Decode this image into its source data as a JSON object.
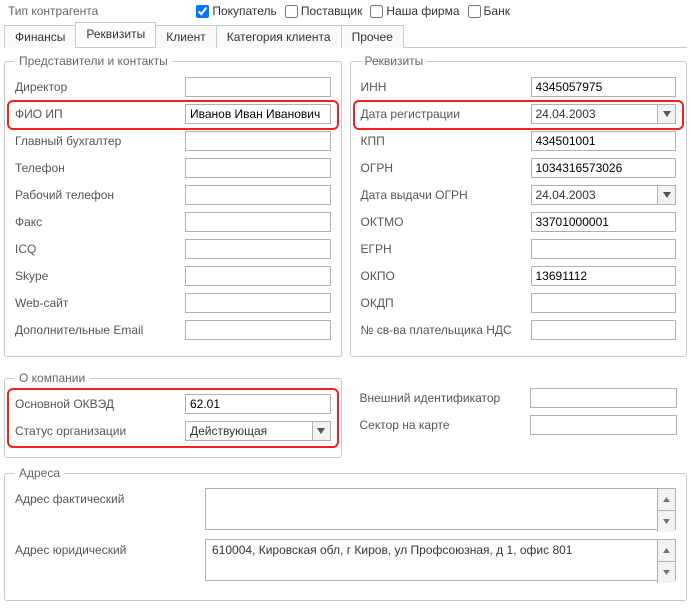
{
  "top": {
    "label": "Тип контрагента",
    "cb_buyer": "Покупатель",
    "cb_supplier": "Поставщик",
    "cb_ourfirm": "Наша фирма",
    "cb_bank": "Банк"
  },
  "tabs": {
    "t0": "Финансы",
    "t1": "Реквизиты",
    "t2": "Клиент",
    "t3": "Категория клиента",
    "t4": "Прочее"
  },
  "fs": {
    "contacts": "Представители и контакты",
    "details": "Реквизиты",
    "company": "О компании",
    "addresses": "Адреса"
  },
  "contacts": {
    "l_director": "Директор",
    "l_fioip": "ФИО ИП",
    "v_fioip": "Иванов Иван Иванович",
    "l_accountant": "Главный бухгалтер",
    "l_phone": "Телефон",
    "l_workphone": "Рабочий телефон",
    "l_fax": "Факс",
    "l_icq": "ICQ",
    "l_skype": "Skype",
    "l_website": "Web-сайт",
    "l_emails": "Дополнительные Email"
  },
  "details": {
    "l_inn": "ИНН",
    "v_inn": "4345057975",
    "l_regdate": "Дата регистрации",
    "v_regdate": "24.04.2003",
    "l_kpp": "КПП",
    "v_kpp": "434501001",
    "l_ogrn": "ОГРН",
    "v_ogrn": "1034316573026",
    "l_ogrndate": "Дата выдачи ОГРН",
    "v_ogrndate": "24.04.2003",
    "l_oktmo": "ОКТМО",
    "v_oktmo": "33701000001",
    "l_egrn": "ЕГРН",
    "v_egrn": "",
    "l_okpo": "ОКПО",
    "v_okpo": "13691112",
    "l_okdp": "ОКДП",
    "v_okdp": "",
    "l_nds": "№ св-ва плательщика НДС",
    "v_nds": ""
  },
  "company": {
    "l_okved": "Основной ОКВЭД",
    "v_okved": "62.01",
    "l_status": "Статус организации",
    "v_status": "Действующая",
    "l_extid": "Внешний идентификатор",
    "l_sector": "Сектор на карте"
  },
  "addresses": {
    "l_fact": "Адрес фактический",
    "v_fact": "",
    "l_legal": "Адрес юридический",
    "v_legal": "610004, Кировская обл, г Киров, ул Профсоюзная, д 1, офис 801"
  }
}
